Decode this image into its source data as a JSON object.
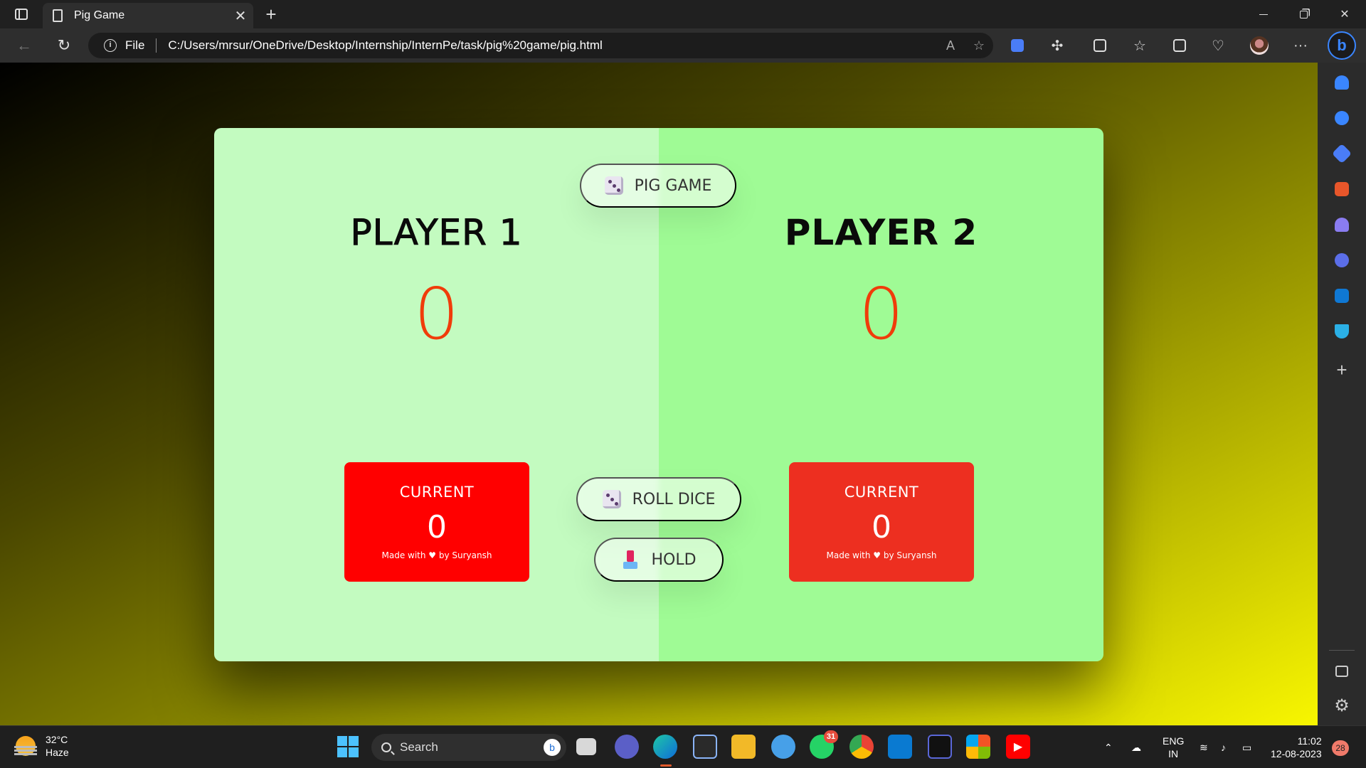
{
  "browser": {
    "tab_title": "Pig Game",
    "tab_close": "✕",
    "new_tab": "+",
    "address": {
      "scheme_label": "File",
      "url": "C:/Users/mrsur/OneDrive/Desktop/Internship/InternPe/task/pig%20game/pig.html"
    }
  },
  "game": {
    "new_game_label": "PIG GAME",
    "roll_label": "ROLL DICE",
    "hold_label": "HOLD",
    "players": [
      {
        "name": "PLAYER 1",
        "score": "0",
        "current_label": "CURRENT",
        "current_score": "0",
        "credit": "Made with ♥ by Suryansh"
      },
      {
        "name": "PLAYER 2",
        "score": "0",
        "current_label": "CURRENT",
        "current_score": "0",
        "credit": "Made with ♥ by Suryansh"
      }
    ],
    "colors": {
      "player1_bg": "#c3fbc0",
      "player2_bg": "#9ffb95",
      "score": "#f03c0a",
      "current1_bg": "#ff0000",
      "current2_bg": "#ed2f20"
    }
  },
  "taskbar": {
    "weather_temp": "32°C",
    "weather_text": "Haze",
    "search_placeholder": "Search",
    "whatsapp_badge": "31",
    "lang_top": "ENG",
    "lang_bottom": "IN",
    "time": "11:02",
    "date": "12-08-2023",
    "notifications": "28"
  }
}
